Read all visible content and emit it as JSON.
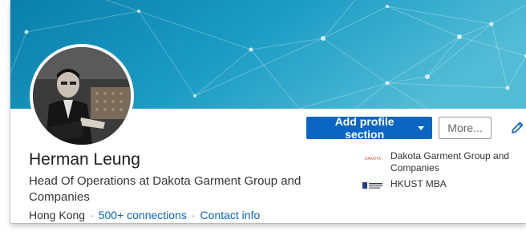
{
  "profile": {
    "name": "Herman Leung",
    "headline": "Head Of Operations at Dakota Garment Group and Companies",
    "location": "Hong Kong",
    "separator": "·",
    "connections": "500+ connections",
    "contact": "Contact info"
  },
  "actions": {
    "add_section_label": "Add profile section",
    "more_label": "More..."
  },
  "side_items": [
    {
      "label": "Dakota Garment Group and Companies",
      "logo": "dakota-logo",
      "logo_text": "DAKOTA"
    },
    {
      "label": "HKUST MBA",
      "logo": "hkust-logo"
    }
  ],
  "colors": {
    "banner_start": "#0b86b0",
    "banner_end": "#4cb6d1",
    "primary": "#0a66c2",
    "text": "#1d1d1d",
    "dakota_red": "#d9534f"
  },
  "icons": {
    "edit": "pencil-icon",
    "dropdown": "caret-down-icon"
  }
}
